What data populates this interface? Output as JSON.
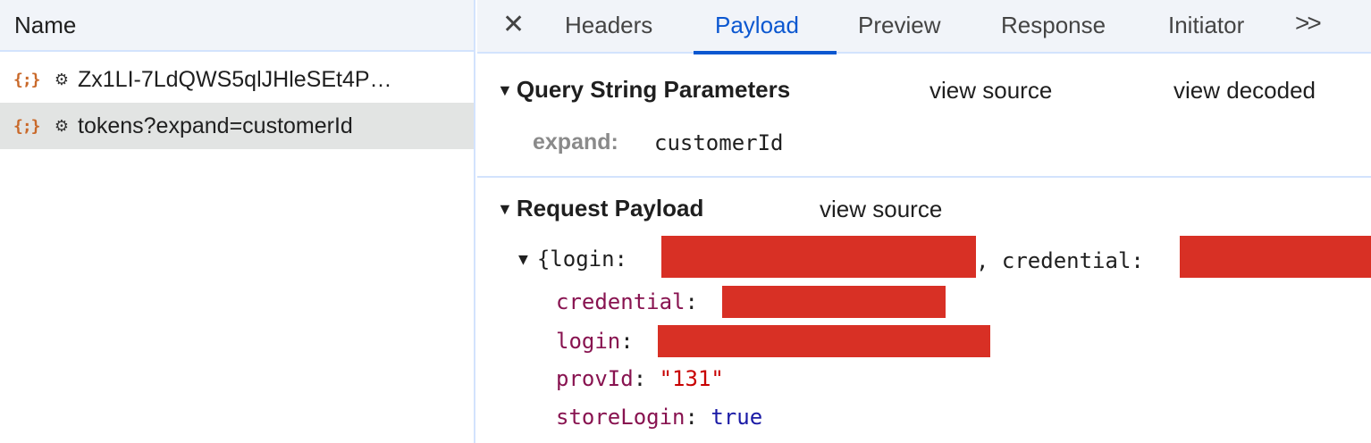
{
  "requests_panel": {
    "header": "Name",
    "requests": [
      {
        "icon": "{;}",
        "name": "Zx1LI-7LdQWS5qlJHleSEt4P…",
        "selected": false
      },
      {
        "icon": "{;}",
        "name": "tokens?expand=customerId",
        "selected": true
      }
    ]
  },
  "detail_panel": {
    "tabs": [
      "Headers",
      "Payload",
      "Preview",
      "Response",
      "Initiator"
    ],
    "active_tab": "Payload",
    "more_label": ">>",
    "query_section": {
      "title": "Query String Parameters",
      "view_source": "view source",
      "view_decoded": "view decoded",
      "params": [
        {
          "key": "expand:",
          "value": "customerId"
        }
      ]
    },
    "payload_section": {
      "title": "Request Payload",
      "view_source": "view source",
      "summary_open": "{login:",
      "summary_mid": ", credential:",
      "properties": [
        {
          "key": "credential",
          "value": ""
        },
        {
          "key": "login",
          "value": ""
        },
        {
          "key": "provId",
          "value": "\"131\""
        },
        {
          "key": "storeLogin",
          "value": "true"
        }
      ]
    }
  },
  "colors": {
    "accent": "#0b57d0",
    "redaction": "#d83025",
    "key": "#881350",
    "string": "#c80000",
    "boolean": "#1a1aa6"
  }
}
